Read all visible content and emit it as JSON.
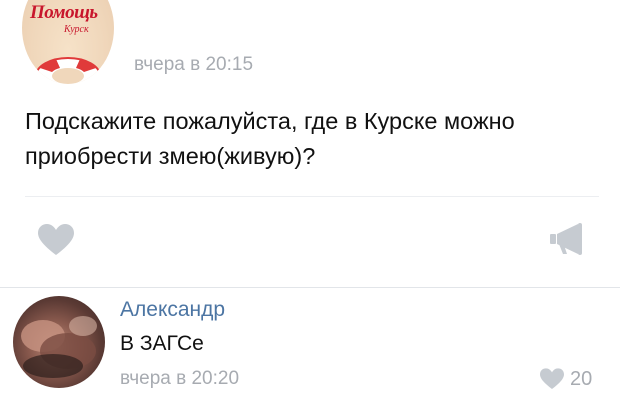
{
  "post": {
    "avatar": {
      "logo_text": "Помощь",
      "logo_subtext": "Курск"
    },
    "time": "вчера в 20:15",
    "text": "Подскажите пожалуйста, где в Курске можно приобрести змею(живую)?",
    "actions": {
      "like_icon": "heart-icon",
      "share_icon": "megaphone-icon"
    }
  },
  "comment": {
    "author": "Александр",
    "text": "В ЗАГСе",
    "time": "вчера в 20:20",
    "likes": "20"
  },
  "colors": {
    "author_link": "#4c75a3",
    "muted_text": "#a7abb1",
    "icon_grey": "#c6cbd1",
    "lifebuoy_red": "#e03a3a",
    "logo_red": "#c8162c"
  }
}
